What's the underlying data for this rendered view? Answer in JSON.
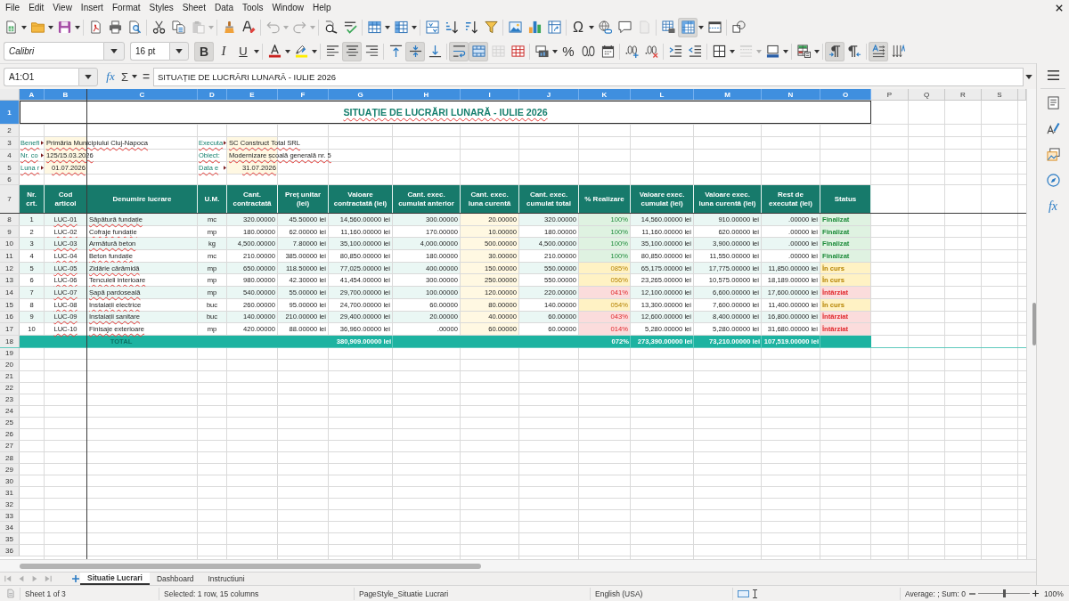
{
  "menu": [
    "File",
    "Edit",
    "View",
    "Insert",
    "Format",
    "Styles",
    "Sheet",
    "Data",
    "Tools",
    "Window",
    "Help"
  ],
  "standard_toolbar": [
    {
      "on": false,
      "disabled": false
    },
    {
      "on": false,
      "disabled": false
    },
    {
      "on": false,
      "disabled": false
    },
    {
      "on": false,
      "disabled": false
    },
    {
      "on": false,
      "disabled": false
    },
    {
      "on": false,
      "disabled": false
    },
    {
      "on": false,
      "disabled": false
    },
    {
      "on": false,
      "disabled": false
    },
    {
      "on": false,
      "disabled": true
    },
    {
      "on": false,
      "disabled": false
    },
    {
      "on": false,
      "disabled": false
    },
    {
      "on": false,
      "disabled": true
    },
    {
      "on": false,
      "disabled": true
    },
    {
      "on": false,
      "disabled": false
    },
    {
      "on": false,
      "disabled": false
    },
    {
      "on": false,
      "disabled": false
    },
    {
      "on": false,
      "disabled": false
    },
    {
      "on": false,
      "disabled": false
    },
    {
      "on": false,
      "disabled": false
    },
    {
      "on": false,
      "disabled": false
    },
    {
      "on": false,
      "disabled": false
    },
    {
      "on": false,
      "disabled": false
    },
    {
      "on": false,
      "disabled": false
    },
    {
      "on": false,
      "disabled": false
    },
    {
      "label": "Ω",
      "on": false,
      "disabled": false
    },
    {
      "on": false,
      "disabled": false
    },
    {
      "on": false,
      "disabled": false
    },
    {
      "on": false,
      "disabled": true
    },
    {
      "on": false,
      "disabled": false
    },
    {
      "on": true,
      "disabled": false
    },
    {
      "on": false,
      "disabled": false
    },
    {
      "on": false,
      "disabled": false
    }
  ],
  "formatting_toolbar": {
    "font_name": "Calibri",
    "font_size": "16 pt",
    "buttons": [
      {
        "label": "B",
        "on": true,
        "disabled": false
      },
      {
        "label": "I",
        "on": false,
        "disabled": false
      },
      {
        "label": "U",
        "on": false,
        "disabled": false
      },
      {
        "on": false,
        "disabled": false
      },
      {
        "on": false,
        "disabled": false
      },
      {
        "on": false,
        "disabled": false
      },
      {
        "on": true,
        "disabled": false
      },
      {
        "on": false,
        "disabled": false
      },
      {
        "on": false,
        "disabled": false
      },
      {
        "on": true,
        "disabled": false
      },
      {
        "on": false,
        "disabled": false
      },
      {
        "on": true,
        "disabled": false
      },
      {
        "on": true,
        "disabled": false
      },
      {
        "on": false,
        "disabled": true
      },
      {
        "on": false,
        "disabled": false
      },
      {
        "on": false,
        "disabled": false
      },
      {
        "label": "%",
        "on": false,
        "disabled": false
      },
      {
        "on": false,
        "disabled": false
      },
      {
        "on": false,
        "disabled": false
      },
      {
        "on": false,
        "disabled": false
      },
      {
        "on": false,
        "disabled": false
      },
      {
        "on": false,
        "disabled": false
      },
      {
        "on": false,
        "disabled": false
      },
      {
        "on": false,
        "disabled": false
      },
      {
        "on": false,
        "disabled": true
      },
      {
        "on": false,
        "disabled": false
      },
      {
        "on": false,
        "disabled": false
      },
      {
        "on": true,
        "disabled": false
      },
      {
        "on": false,
        "disabled": false
      },
      {
        "on": true,
        "disabled": false
      },
      {
        "on": false,
        "disabled": false
      }
    ]
  },
  "formula_bar": {
    "name_box": "A1:O1",
    "function_wizard": "fx",
    "sum": "Σ",
    "equals": "=",
    "content": "SITUAȚIE DE LUCRĂRI LUNARĂ - IULIE 2026"
  },
  "sidebar": {
    "functions": "fx"
  },
  "sheet": {
    "columns": [
      {
        "label": "A",
        "selected": true
      },
      {
        "label": "B",
        "selected": true
      },
      {
        "label": "C",
        "selected": true
      },
      {
        "label": "D",
        "selected": true
      },
      {
        "label": "E",
        "selected": true
      },
      {
        "label": "F",
        "selected": true
      },
      {
        "label": "G",
        "selected": true
      },
      {
        "label": "H",
        "selected": true
      },
      {
        "label": "I",
        "selected": true
      },
      {
        "label": "J",
        "selected": true
      },
      {
        "label": "K",
        "selected": true
      },
      {
        "label": "L",
        "selected": true
      },
      {
        "label": "M",
        "selected": true
      },
      {
        "label": "N",
        "selected": true
      },
      {
        "label": "O",
        "selected": true
      },
      {
        "label": "P",
        "selected": false
      },
      {
        "label": "Q",
        "selected": false
      },
      {
        "label": "R",
        "selected": false
      },
      {
        "label": "S",
        "selected": false
      }
    ],
    "rows": [
      {
        "label": "1",
        "selected": true
      },
      {
        "label": "2",
        "selected": false
      },
      {
        "label": "3",
        "selected": false
      },
      {
        "label": "4",
        "selected": false
      },
      {
        "label": "5",
        "selected": false
      },
      {
        "label": "6",
        "selected": false
      },
      {
        "label": "7",
        "selected": false
      },
      {
        "label": "8",
        "selected": false
      },
      {
        "label": "9",
        "selected": false
      },
      {
        "label": "10",
        "selected": false
      },
      {
        "label": "11",
        "selected": false
      },
      {
        "label": "12",
        "selected": false
      },
      {
        "label": "13",
        "selected": false
      },
      {
        "label": "14",
        "selected": false
      },
      {
        "label": "15",
        "selected": false
      },
      {
        "label": "16",
        "selected": false
      },
      {
        "label": "17",
        "selected": false
      },
      {
        "label": "18",
        "selected": false
      },
      {
        "label": "19",
        "selected": false
      },
      {
        "label": "20",
        "selected": false
      },
      {
        "label": "21",
        "selected": false
      },
      {
        "label": "22",
        "selected": false
      },
      {
        "label": "23",
        "selected": false
      },
      {
        "label": "24",
        "selected": false
      },
      {
        "label": "25",
        "selected": false
      },
      {
        "label": "26",
        "selected": false
      },
      {
        "label": "27",
        "selected": false
      },
      {
        "label": "28",
        "selected": false
      },
      {
        "label": "29",
        "selected": false
      },
      {
        "label": "30",
        "selected": false
      },
      {
        "label": "31",
        "selected": false
      },
      {
        "label": "32",
        "selected": false
      },
      {
        "label": "33",
        "selected": false
      },
      {
        "label": "34",
        "selected": false
      },
      {
        "label": "35",
        "selected": false
      },
      {
        "label": "36",
        "selected": false
      }
    ],
    "title": "SITUAȚIE DE LUCRĂRI LUNARĂ - IULIE 2026",
    "info": [
      [
        {
          "label": "Benefi",
          "clipped": true,
          "kind": "text",
          "value": "Primăria Municipiului Cluj-Napoca"
        },
        {
          "label": "Executa",
          "clipped": true,
          "kind": "text",
          "value": "SC Construct Total SRL"
        }
      ],
      [
        {
          "label": "Nr. co",
          "clipped": true,
          "kind": "text",
          "value": "125/15.03.2026"
        },
        {
          "label": "Obiect:",
          "clipped": false,
          "kind": "text",
          "value": "Modernizare școală generală nr. 5"
        }
      ],
      [
        {
          "label": "Luna r",
          "clipped": true,
          "kind": "date",
          "value": "01.07.2026"
        },
        {
          "label": "Data e",
          "clipped": true,
          "kind": "date",
          "value": "31.07.2026"
        }
      ]
    ],
    "headers": [
      "Nr. crt.",
      "Cod articol",
      "Denumire lucrare",
      "U.M.",
      "Cant. contractată",
      "Preț unitar (lei)",
      "Valoare contractată (lei)",
      "Cant. exec. cumulat anterior",
      "Cant. exec. luna curentă",
      "Cant. exec. cumulat total",
      "% Realizare",
      "Valoare exec. cumulat (lei)",
      "Valoare exec. luna curentă (lei)",
      "Rest de executat (lei)",
      "Status"
    ],
    "items": [
      {
        "cells": [
          "1",
          "LUC-01",
          "Săpătură fundație",
          "mc",
          "320.00000",
          "45.50000 lei",
          "14,560.00000 lei",
          "300.00000",
          "20.00000",
          "320.00000",
          "100%",
          "14,560.00000 lei",
          "910.00000 lei",
          ".00000 lei",
          "Finalizat"
        ],
        "kind": "done"
      },
      {
        "cells": [
          "2",
          "LUC-02",
          "Cofraje fundație",
          "mp",
          "180.00000",
          "62.00000 lei",
          "11,160.00000 lei",
          "170.00000",
          "10.00000",
          "180.00000",
          "100%",
          "11,160.00000 lei",
          "620.00000 lei",
          ".00000 lei",
          "Finalizat"
        ],
        "kind": "done"
      },
      {
        "cells": [
          "3",
          "LUC-03",
          "Armătură beton",
          "kg",
          "4,500.00000",
          "7.80000 lei",
          "35,100.00000 lei",
          "4,000.00000",
          "500.00000",
          "4,500.00000",
          "100%",
          "35,100.00000 lei",
          "3,900.00000 lei",
          ".00000 lei",
          "Finalizat"
        ],
        "kind": "done"
      },
      {
        "cells": [
          "4",
          "LUC-04",
          "Beton fundație",
          "mc",
          "210.00000",
          "385.00000 lei",
          "80,850.00000 lei",
          "180.00000",
          "30.00000",
          "210.00000",
          "100%",
          "80,850.00000 lei",
          "11,550.00000 lei",
          ".00000 lei",
          "Finalizat"
        ],
        "kind": "done"
      },
      {
        "cells": [
          "5",
          "LUC-05",
          "Zidărie cărămidă",
          "mp",
          "650.00000",
          "118.50000 lei",
          "77,025.00000 lei",
          "400.00000",
          "150.00000",
          "550.00000",
          "085%",
          "65,175.00000 lei",
          "17,775.00000 lei",
          "11,850.00000 lei",
          "În curs"
        ],
        "kind": "progress"
      },
      {
        "cells": [
          "6",
          "LUC-06",
          "Tencuieli interioare",
          "mp",
          "980.00000",
          "42.30000 lei",
          "41,454.00000 lei",
          "300.00000",
          "250.00000",
          "550.00000",
          "056%",
          "23,265.00000 lei",
          "10,575.00000 lei",
          "18,189.00000 lei",
          "În curs"
        ],
        "kind": "progress"
      },
      {
        "cells": [
          "7",
          "LUC-07",
          "Șapă pardoseală",
          "mp",
          "540.00000",
          "55.00000 lei",
          "29,700.00000 lei",
          "100.00000",
          "120.00000",
          "220.00000",
          "041%",
          "12,100.00000 lei",
          "6,600.00000 lei",
          "17,600.00000 lei",
          "Întârziat"
        ],
        "kind": "late"
      },
      {
        "cells": [
          "8",
          "LUC-08",
          "Instalații electrice",
          "buc",
          "260.00000",
          "95.00000 lei",
          "24,700.00000 lei",
          "60.00000",
          "80.00000",
          "140.00000",
          "054%",
          "13,300.00000 lei",
          "7,600.00000 lei",
          "11,400.00000 lei",
          "În curs"
        ],
        "kind": "progress"
      },
      {
        "cells": [
          "9",
          "LUC-09",
          "Instalații sanitare",
          "buc",
          "140.00000",
          "210.00000 lei",
          "29,400.00000 lei",
          "20.00000",
          "40.00000",
          "60.00000",
          "043%",
          "12,600.00000 lei",
          "8,400.00000 lei",
          "16,800.00000 lei",
          "Întârziat"
        ],
        "kind": "late"
      },
      {
        "cells": [
          "10",
          "LUC-10",
          "Finisaje exterioare",
          "mp",
          "420.00000",
          "88.00000 lei",
          "36,960.00000 lei",
          ".00000",
          "60.00000",
          "60.00000",
          "014%",
          "5,280.00000 lei",
          "5,280.00000 lei",
          "31,680.00000 lei",
          "Întârziat"
        ],
        "kind": "late"
      }
    ],
    "total": {
      "label": "TOTAL",
      "contract_value": "380,909.00000 lei",
      "percent": "072%",
      "exec_cumulative": "273,390.00000 lei",
      "exec_month": "73,210.00000 lei",
      "remaining": "107,519.00000 lei"
    }
  },
  "sheet_tabs": [
    {
      "label": "Situatie Lucrari",
      "selected": true
    },
    {
      "label": "Dashboard",
      "selected": false
    },
    {
      "label": "Instructiuni",
      "selected": false
    }
  ],
  "status_bar": {
    "sheet": "Sheet 1 of 3",
    "selection": "Selected: 1 row, 15 columns",
    "page_style": "PageStyle_Situatie Lucrari",
    "language": "English (USA)",
    "summary": "Average: ; Sum: 0",
    "zoom": {
      "level": 0.5,
      "reading": "100%"
    }
  }
}
